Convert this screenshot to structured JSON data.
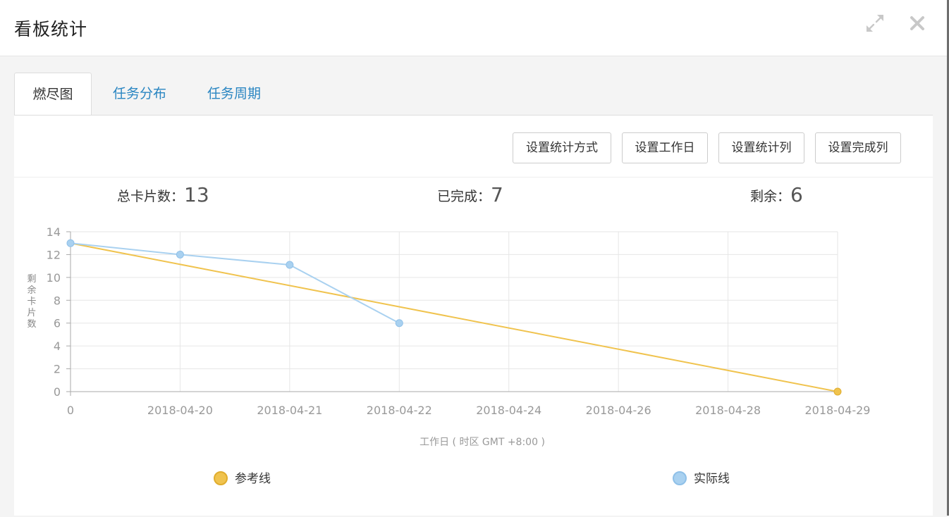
{
  "dialog": {
    "title": "看板统计",
    "expand_icon": "expand-icon",
    "close_icon": "close-icon"
  },
  "tabs": [
    {
      "label": "燃尽图",
      "active": true
    },
    {
      "label": "任务分布",
      "active": false
    },
    {
      "label": "任务周期",
      "active": false
    }
  ],
  "toolbar": {
    "buttons": [
      "设置统计方式",
      "设置工作日",
      "设置统计列",
      "设置完成列"
    ]
  },
  "stats": {
    "total_label": "总卡片数：",
    "total_value": "13",
    "done_label": "已完成：",
    "done_value": "7",
    "remaining_label": "剩余：",
    "remaining_value": "6"
  },
  "chart_data": {
    "type": "line",
    "categories": [
      "0",
      "2018-04-20",
      "2018-04-21",
      "2018-04-22",
      "2018-04-24",
      "2018-04-26",
      "2018-04-28",
      "2018-04-29"
    ],
    "ylabel": "剩余卡片数",
    "xlabel": "工作日 ( 时区 GMT +8:00 )",
    "ylim": [
      0,
      14
    ],
    "yticks": [
      0,
      2,
      4,
      6,
      8,
      10,
      12,
      14
    ],
    "grid": true,
    "legend_position": "bottom",
    "series": [
      {
        "name": "参考线",
        "color": "#f0c34e",
        "values": [
          13,
          null,
          null,
          null,
          null,
          null,
          null,
          0
        ]
      },
      {
        "name": "实际线",
        "color": "#a9d1f0",
        "values": [
          13,
          12,
          11.1,
          6,
          null,
          null,
          null,
          null
        ]
      }
    ]
  }
}
